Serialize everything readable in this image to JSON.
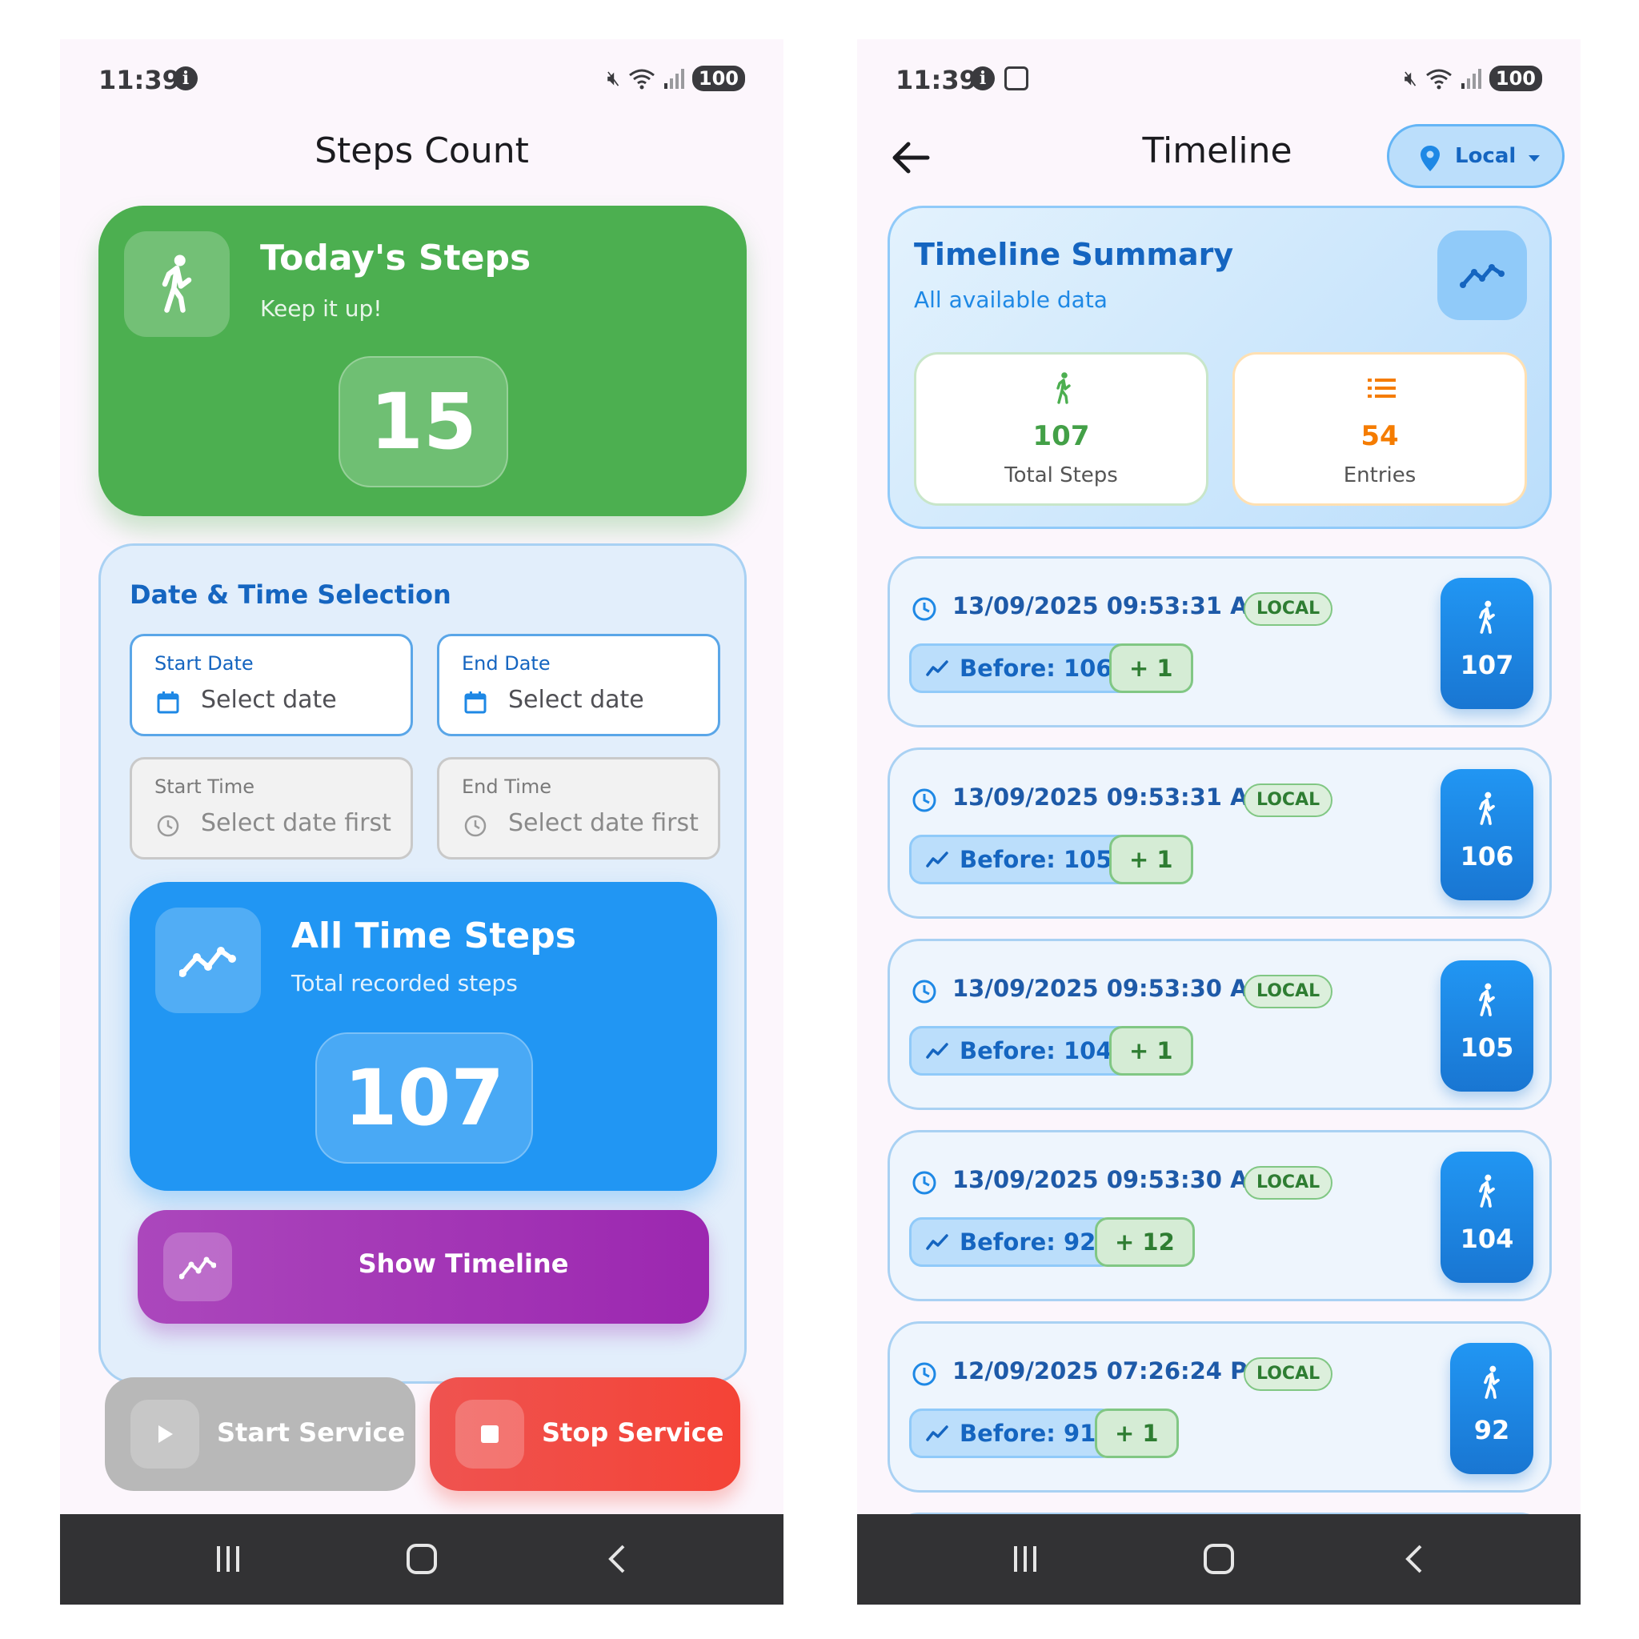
{
  "left": {
    "status": {
      "time": "11:39",
      "battery": "100"
    },
    "title": "Steps Count",
    "today": {
      "title": "Today's Steps",
      "subtitle": "Keep it up!",
      "count": "15"
    },
    "date_time": {
      "title": "Date & Time Selection",
      "start_date": {
        "label": "Start Date",
        "value": "Select date"
      },
      "end_date": {
        "label": "End Date",
        "value": "Select date"
      },
      "start_time": {
        "label": "Start Time",
        "value": "Select date first"
      },
      "end_time": {
        "label": "End Time",
        "value": "Select date first"
      }
    },
    "all_time": {
      "title": "All Time Steps",
      "subtitle": "Total recorded steps",
      "count": "107"
    },
    "show_timeline_label": "Show Timeline",
    "start_service_label": "Start Service",
    "stop_service_label": "Stop Service"
  },
  "right": {
    "status": {
      "time": "11:39",
      "battery": "100"
    },
    "title": "Timeline",
    "source_label": "Local",
    "summary": {
      "title": "Timeline Summary",
      "subtitle": "All available data",
      "total_steps": "107",
      "total_steps_label": "Total Steps",
      "entries": "54",
      "entries_label": "Entries"
    },
    "entries": [
      {
        "time": "13/09/2025 09:53:31 AM",
        "badge": "LOCAL",
        "before": "Before: 106",
        "delta": "+ 1",
        "total": "107"
      },
      {
        "time": "13/09/2025 09:53:31 AM",
        "badge": "LOCAL",
        "before": "Before: 105",
        "delta": "+ 1",
        "total": "106"
      },
      {
        "time": "13/09/2025 09:53:30 AM",
        "badge": "LOCAL",
        "before": "Before: 104",
        "delta": "+ 1",
        "total": "105"
      },
      {
        "time": "13/09/2025 09:53:30 AM",
        "badge": "LOCAL",
        "before": "Before: 92",
        "delta": "+ 12",
        "total": "104"
      },
      {
        "time": "12/09/2025 07:26:24 PM",
        "badge": "LOCAL",
        "before": "Before: 91",
        "delta": "+ 1",
        "total": "92"
      }
    ]
  },
  "colors": {
    "green": "#4caf50",
    "blue": "#2196f3",
    "purple": "#9c27b0",
    "red": "#f44336",
    "orange": "#f57c00",
    "dark_blue": "#1565c0"
  }
}
